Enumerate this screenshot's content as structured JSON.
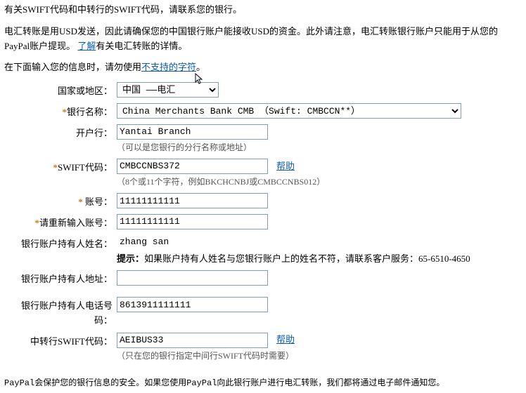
{
  "intro": {
    "line1": "有关SWIFT代码和中转行的SWIFT代码，请联系您的银行。",
    "line2a": "电汇转账是用USD发送，因此请确保您的中国银行账户能接收USD的资金。此外请注意，电汇转账银行账户只能用于从您的PayPal账户提现。",
    "learnMoreLink": "了解",
    "line2b": "有关电汇转账的详情。",
    "line3a": "在下面输入您的信息时，请勿使用",
    "unsupportedLink": "不支持的字符",
    "line3b": "。"
  },
  "form": {
    "countryLabel": "国家或地区：",
    "countryValue": "中国 ——电汇",
    "bankNameLabel": "银行名称：",
    "bankNameValue": "China Merchants Bank CMB （Swift: CMBCCN**）",
    "branchLabel": "开户行：",
    "branchValue": "Yantai Branch",
    "branchHint": "（可以是您银行的分行名称或地址）",
    "swiftLabel": "SWIFT代码：",
    "swiftValue": "CMBCCNBS372",
    "swiftHint": "（8个或11个字符，例如BKCHCNBJ或CMBCCNBS012）",
    "helpText": "帮助",
    "accountLabel": "账号：",
    "accountValue": "11111111111",
    "accountConfirmLabel": "请重新输入账号：",
    "accountConfirmValue": "11111111111",
    "holderNameLabel": "银行账户持有人姓名：",
    "holderNameValue": "zhang san",
    "tipLabel": "提示：",
    "tipText": "如果账户持有人姓名与您银行账户上的姓名不符，请联系客户服务：65-6510-4650",
    "holderAddrLabel": "银行账户持有人地址：",
    "holderAddrValue": "",
    "holderPhoneLabel": "银行账户持有人电话号码：",
    "holderPhoneValue": "8613911111111",
    "interSwiftLabel": "中转行SWIFT代码：",
    "interSwiftValue": "AEIBUS33",
    "interSwiftHint": "（只在您的银行指定中间行SWIFT代码时需要）"
  },
  "footer": "PayPal会保护您的银行信息的安全。如果您使用PayPal向此银行账户进行电汇转账，我们都将通过电子邮件通知您。"
}
